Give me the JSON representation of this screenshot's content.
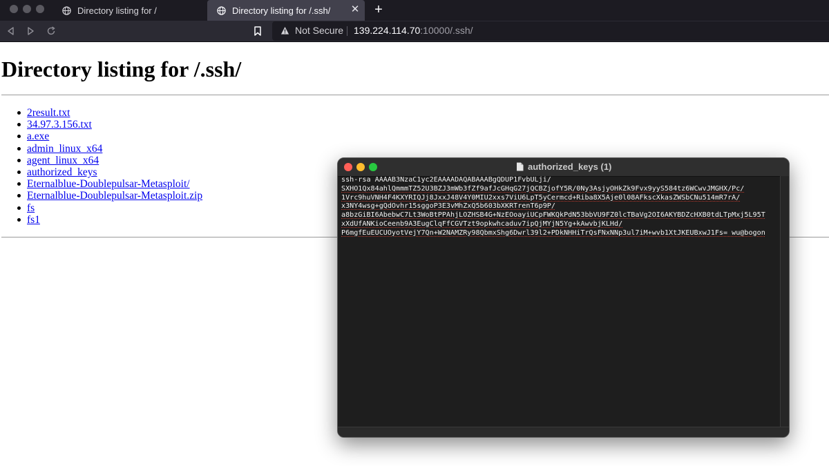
{
  "browser": {
    "tabs": [
      {
        "label": "Directory listing for /",
        "active": false
      },
      {
        "label": "Directory listing for /.ssh/",
        "active": true
      }
    ],
    "tab_close_glyph": "✕",
    "new_tab_glyph": "+",
    "security_label": "Not Secure",
    "url_host": "139.224.114.70",
    "url_rest": ":10000/.ssh/"
  },
  "page": {
    "title": "Directory listing for /.ssh/",
    "files": [
      "2result.txt",
      "34.97.3.156.txt",
      "a.exe",
      "admin_linux_x64",
      "agent_linux_x64",
      "authorized_keys",
      "Eternalblue-Doublepulsar-Metasploit/",
      "Eternalblue-Doublepulsar-Metasploit.zip",
      "fs",
      "fs1"
    ]
  },
  "text_window": {
    "title": "authorized_keys (1)",
    "lines": [
      "ssh-rsa AAAAB3NzaC1yc2EAAAADAQABAAABgQDUP1FvbULji/",
      "SXHO1Qx84ahlQmmmTZ52U3BZJ3mWb3fZf9afJcGHqG27jQCBZjofY5R/0Ny3AsjyOHkZk9Fvx9yyS584tz6WCwvJMGHX/Pc/",
      "1Vrc9huVNH4F4KXYRIQJj8JxxJ48V4Y0MIU2xxs7ViU6LpT5yCermcd+Riba8X5Aje0l08AFkscXkasZWSbCNu514mR7rA/",
      "x3NY4wsg+gQdOvhr15sggoP3E3vMhZxQ5b603bXKRTrenT6p9P/",
      "a8bzGiBI6AbebwC7Lt3WoBtPPAhjLOZHSB4G+NzEOoayiUCpFWKQkPdN53bbVU9FZ0lcTBaVg2OI6AKYBDZcHXB0tdLTpMxj5L95T",
      "xXdUfANKioCeenb9A3EugClqFfCGVTzt9opkwhcaduv7ipQjMYjN5Yg+kAwvbjKLHd/",
      "P6mgfEuEUCUOyotVejY7Qn+W2NAMZRy98QbmxShg6Dwrl39l2+PDkNHHiTrQsFNxNNp3ul7iM+wvb1XtJKEUBxwJ1Fs= wu@bogon"
    ]
  },
  "colors": {
    "link": "#0000ee",
    "tab_bar": "#1c1b22",
    "nav_bar": "#2b2a33",
    "close_light": "#ff5f57",
    "minimize_light": "#febc2e",
    "zoom_light": "#28c840"
  }
}
